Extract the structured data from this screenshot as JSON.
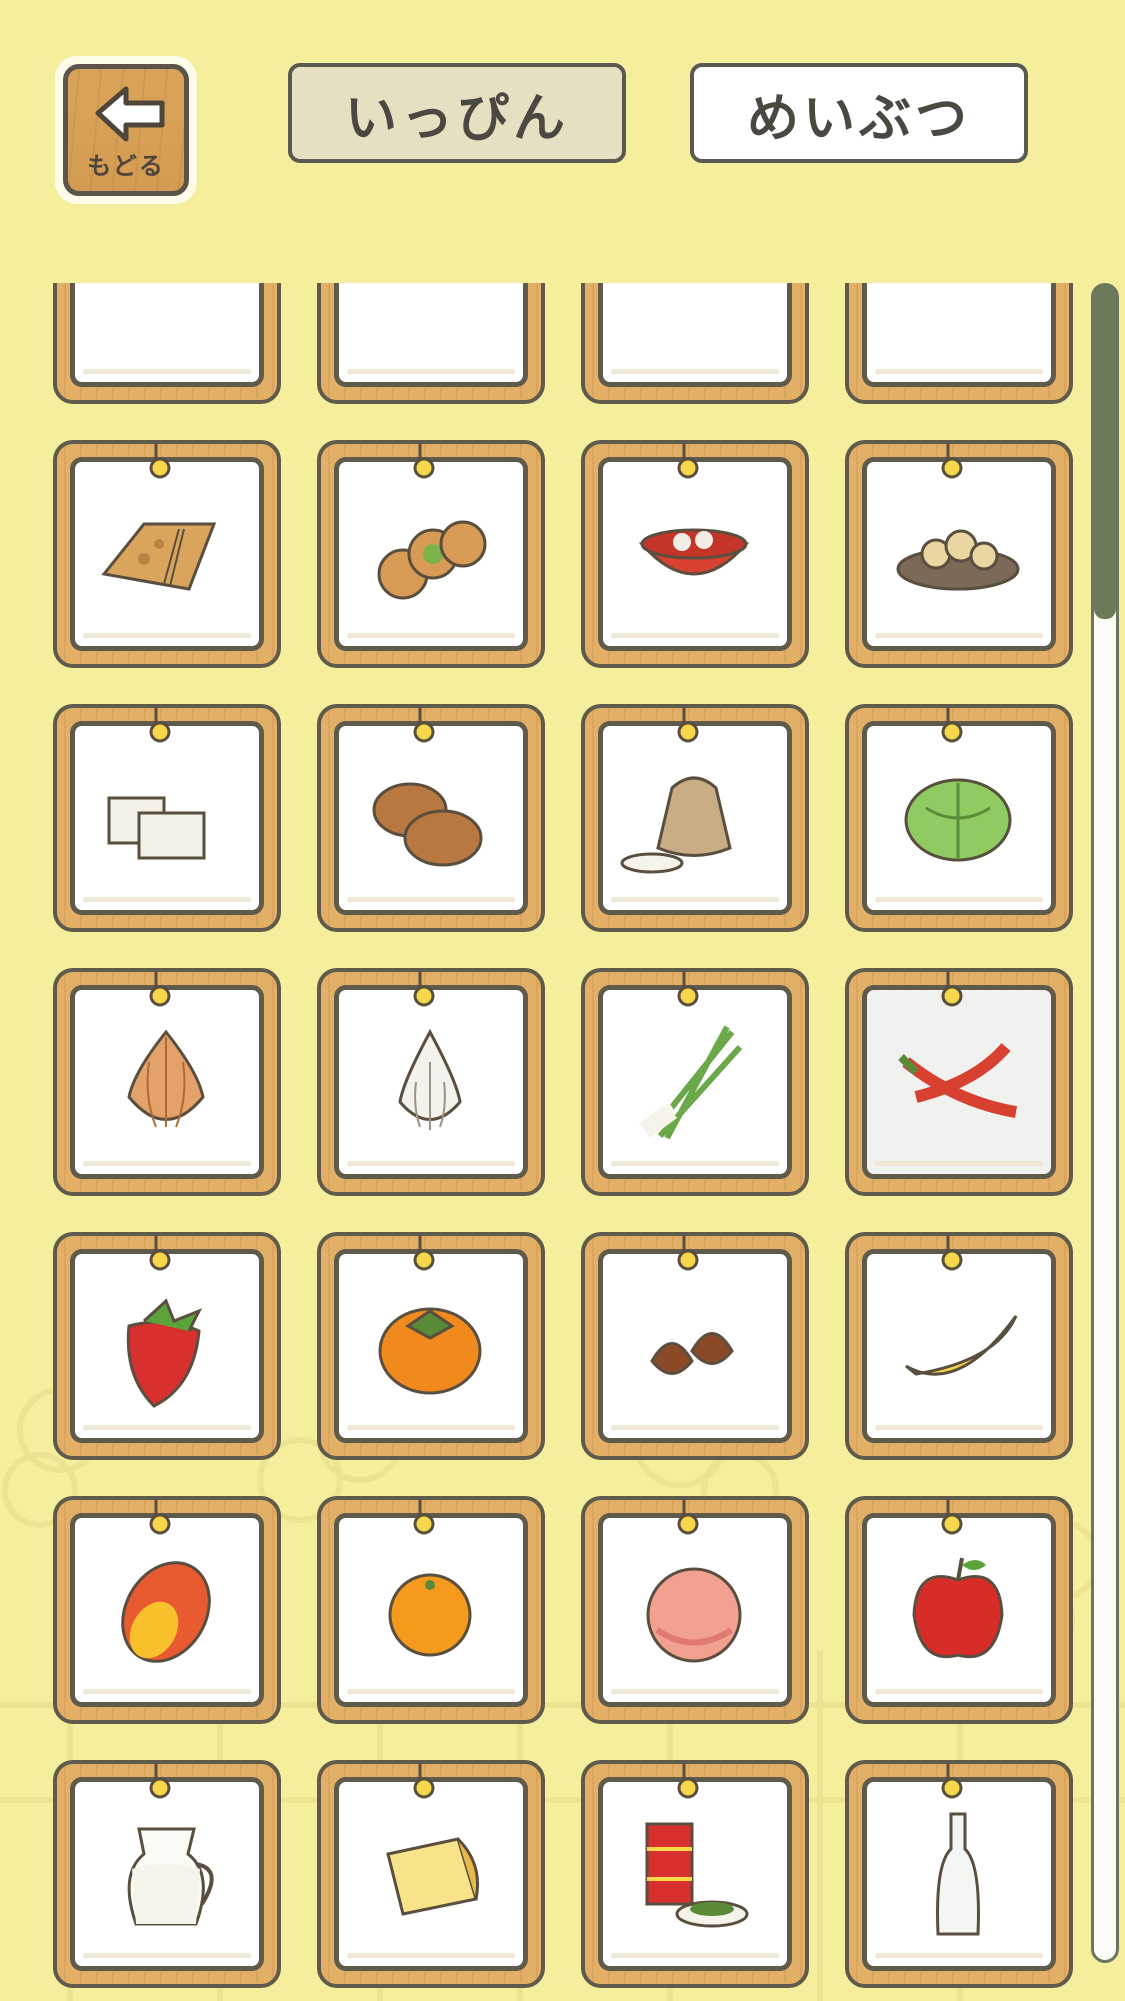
{
  "header": {
    "back_label": "もどる",
    "tabs": [
      {
        "label": "いっぴん",
        "selected": true
      },
      {
        "label": "めいぶつ",
        "selected": false
      }
    ]
  },
  "items": [
    {
      "name": "item-partial-1"
    },
    {
      "name": "item-partial-2"
    },
    {
      "name": "item-partial-3"
    },
    {
      "name": "item-partial-4"
    },
    {
      "name": "senbei-rice-cracker"
    },
    {
      "name": "manju-cakes"
    },
    {
      "name": "zenzai-red-bowl"
    },
    {
      "name": "fried-snack-plate"
    },
    {
      "name": "tofu-blocks"
    },
    {
      "name": "bread-buns"
    },
    {
      "name": "rice-sack"
    },
    {
      "name": "cabbage"
    },
    {
      "name": "onion"
    },
    {
      "name": "garlic"
    },
    {
      "name": "green-onion"
    },
    {
      "name": "chili-peppers"
    },
    {
      "name": "strawberry"
    },
    {
      "name": "persimmon"
    },
    {
      "name": "chestnuts"
    },
    {
      "name": "banana"
    },
    {
      "name": "mango"
    },
    {
      "name": "mandarin-orange"
    },
    {
      "name": "peach"
    },
    {
      "name": "apple"
    },
    {
      "name": "milk-jug"
    },
    {
      "name": "cheese"
    },
    {
      "name": "tea-canister"
    },
    {
      "name": "glass-bottle"
    }
  ],
  "colors": {
    "background": "#f4ee9d",
    "card_wood": "#e1b066",
    "outline": "#5f5a4a",
    "scroll_thumb": "#6a7a5a"
  },
  "scroll": {
    "position_fraction": 0.0
  }
}
